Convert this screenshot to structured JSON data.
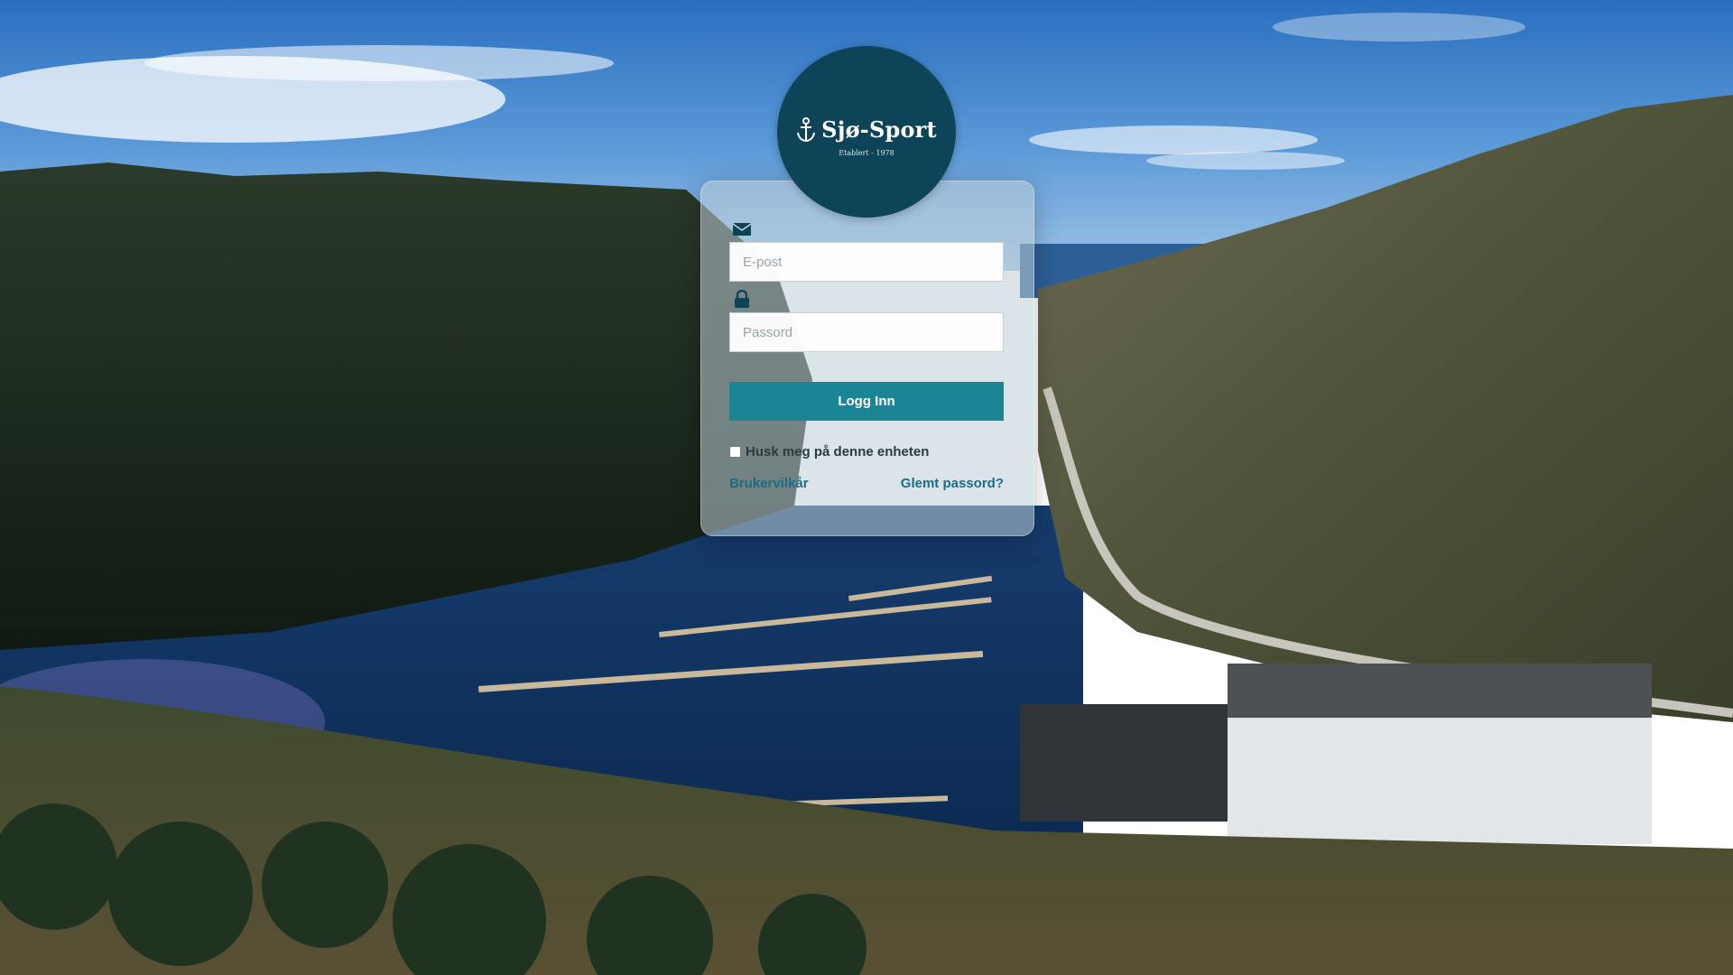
{
  "brand": {
    "name": "Sjø-Sport",
    "tagline": "Etablert - 1978",
    "logo_icon": "anchor-icon",
    "logo_color": "#0d4457"
  },
  "form": {
    "email_icon": "envelope-icon",
    "email_placeholder": "E-post",
    "email_value": "",
    "password_icon": "lock-icon",
    "password_placeholder": "Passord",
    "password_value": "",
    "login_label": "Logg Inn",
    "login_color": "#1b8596",
    "remember_label": "Husk meg på denne enheten",
    "remember_checked": false,
    "terms_link": "Brukervilkår",
    "forgot_link": "Glemt passord?",
    "link_color": "#1a6c86"
  }
}
